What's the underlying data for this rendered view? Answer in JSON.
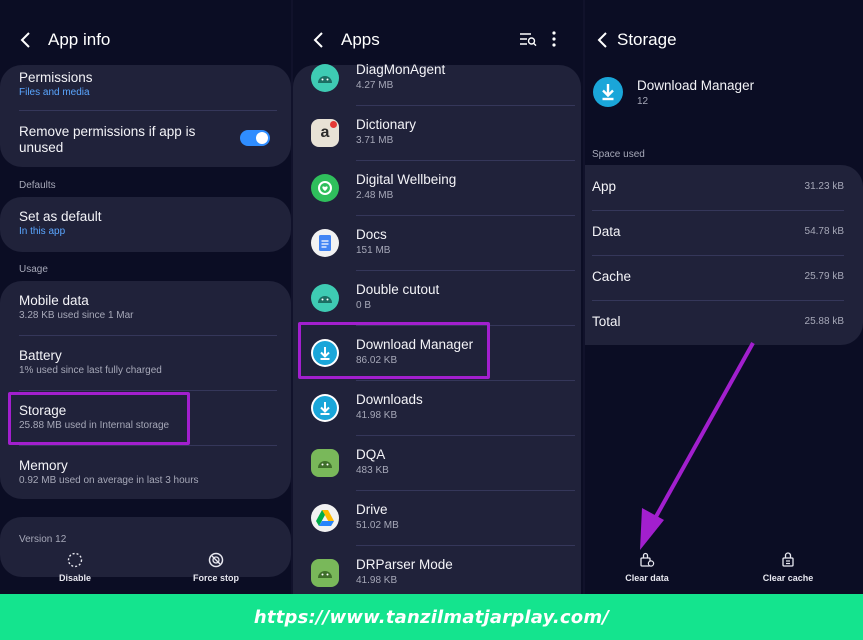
{
  "panel1": {
    "title": "App info",
    "permissions": {
      "label": "Permissions",
      "sub": "Files and media"
    },
    "remove_permissions": {
      "label": "Remove permissions if app is unused",
      "enabled": true
    },
    "defaults_section": "Defaults",
    "set_default": {
      "label": "Set as default",
      "sub": "In this app"
    },
    "usage_section": "Usage",
    "mobile_data": {
      "label": "Mobile data",
      "sub": "3.28 KB used since 1 Mar"
    },
    "battery": {
      "label": "Battery",
      "sub": "1% used since last fully charged"
    },
    "storage": {
      "label": "Storage",
      "sub": "25.88 MB used in Internal storage"
    },
    "memory": {
      "label": "Memory",
      "sub": "0.92 MB used on average in last 3 hours"
    },
    "version": "Version 12",
    "disable_label": "Disable",
    "force_stop_label": "Force stop"
  },
  "panel2": {
    "title": "Apps",
    "apps": [
      {
        "name": "DiagMonAgent",
        "size": "4.27 MB",
        "icon": "android-icon"
      },
      {
        "name": "Dictionary",
        "size": "3.71 MB",
        "icon": "dictionary-icon"
      },
      {
        "name": "Digital Wellbeing",
        "size": "2.48 MB",
        "icon": "wellbeing-icon"
      },
      {
        "name": "Docs",
        "size": "151 MB",
        "icon": "docs-icon"
      },
      {
        "name": "Double cutout",
        "size": "0 B",
        "icon": "android-icon"
      },
      {
        "name": "Download Manager",
        "size": "86.02 KB",
        "icon": "download-icon"
      },
      {
        "name": "Downloads",
        "size": "41.98 KB",
        "icon": "download-icon"
      },
      {
        "name": "DQA",
        "size": "483 KB",
        "icon": "android-icon"
      },
      {
        "name": "Drive",
        "size": "51.02 MB",
        "icon": "drive-icon"
      },
      {
        "name": "DRParser Mode",
        "size": "41.98 KB",
        "icon": "android-icon"
      }
    ]
  },
  "panel3": {
    "title": "Storage",
    "app_name": "Download Manager",
    "app_version": "12",
    "space_used_section": "Space used",
    "rows": [
      {
        "label": "App",
        "value": "31.23 kB"
      },
      {
        "label": "Data",
        "value": "54.78 kB"
      },
      {
        "label": "Cache",
        "value": "25.79 kB"
      },
      {
        "label": "Total",
        "value": "25.88 kB"
      }
    ],
    "clear_data_label": "Clear data",
    "clear_cache_label": "Clear cache"
  },
  "footer_url": "https://www.tanzilmatjarplay.com/",
  "colors": {
    "highlight": "#a21fce",
    "footer": "#14e48e",
    "accent_blue": "#5aa6ff",
    "toggle": "#2f8dff"
  }
}
